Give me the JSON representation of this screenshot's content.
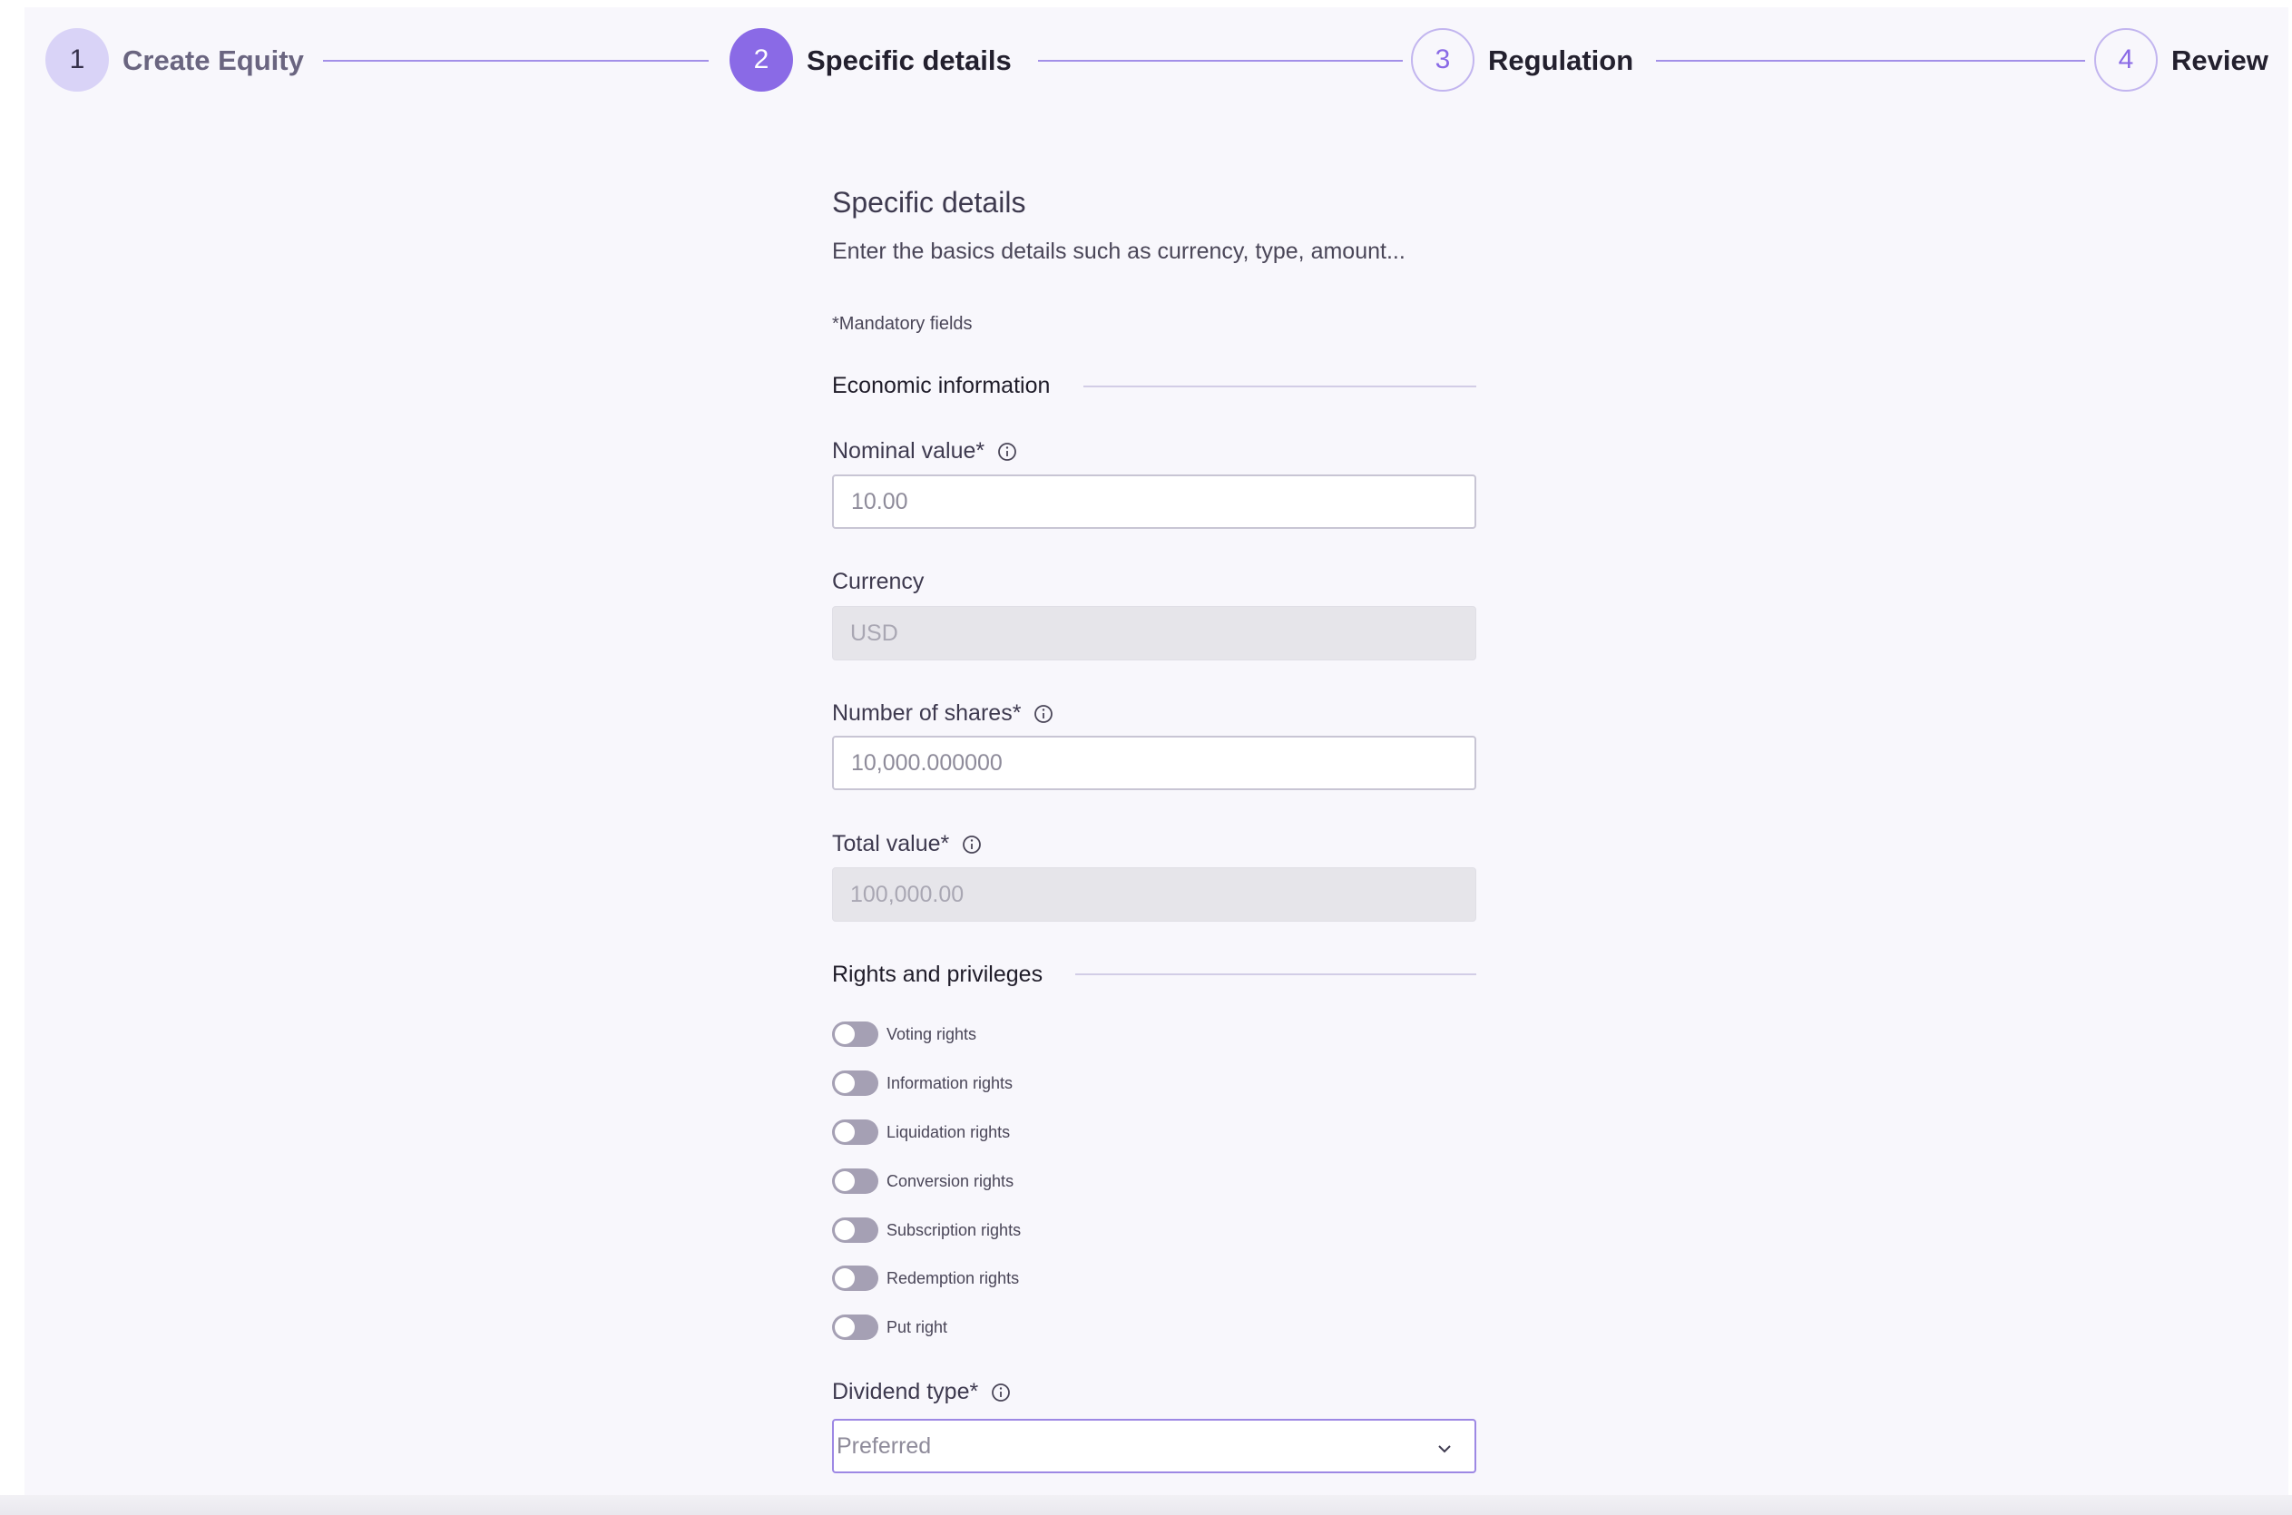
{
  "stepper": {
    "steps": [
      {
        "number": "1",
        "label": "Create Equity",
        "state": "completed"
      },
      {
        "number": "2",
        "label": "Specific details",
        "state": "active"
      },
      {
        "number": "3",
        "label": "Regulation",
        "state": "pending"
      },
      {
        "number": "4",
        "label": "Review",
        "state": "pending"
      }
    ]
  },
  "form": {
    "title": "Specific details",
    "subtitle": "Enter the basics details such as currency, type, amount...",
    "mandatory_note": "*Mandatory fields",
    "economic_section": {
      "title": "Economic information",
      "nominal_value": {
        "label": "Nominal value*",
        "placeholder": "10.00"
      },
      "currency": {
        "label": "Currency",
        "value": "USD"
      },
      "number_of_shares": {
        "label": "Number of shares*",
        "placeholder": "10,000.000000"
      },
      "total_value": {
        "label": "Total value*",
        "value": "100,000.00"
      }
    },
    "rights_section": {
      "title": "Rights and privileges",
      "toggles": [
        {
          "label": "Voting rights",
          "on": false
        },
        {
          "label": "Information rights",
          "on": false
        },
        {
          "label": "Liquidation rights",
          "on": false
        },
        {
          "label": "Conversion rights",
          "on": false
        },
        {
          "label": "Subscription rights",
          "on": false
        },
        {
          "label": "Redemption rights",
          "on": false
        },
        {
          "label": "Put right",
          "on": false
        }
      ]
    },
    "dividend_type": {
      "label": "Dividend type*",
      "value": "Preferred"
    }
  },
  "colors": {
    "accent": "#8a6ae6",
    "accent_light": "#d9d3f7",
    "page_background": "#f8f7fc",
    "toggle_off": "#a5a0b4"
  },
  "icons": {
    "info": "info-circle-icon",
    "dropdown": "chevron-down-icon"
  }
}
